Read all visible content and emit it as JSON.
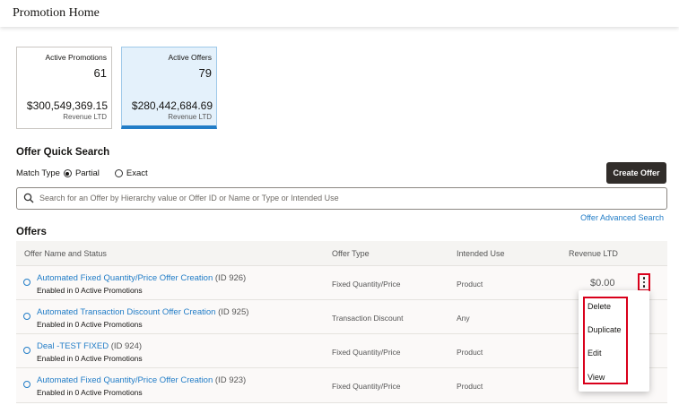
{
  "header": {
    "title": "Promotion Home"
  },
  "cards": [
    {
      "label": "Active Promotions",
      "count": "61",
      "amount": "$300,549,369.15",
      "sub": "Revenue LTD",
      "selected": false
    },
    {
      "label": "Active Offers",
      "count": "79",
      "amount": "$280,442,684.69",
      "sub": "Revenue LTD",
      "selected": true
    }
  ],
  "quick_search": {
    "title": "Offer Quick Search",
    "match_type_label": "Match Type",
    "partial_label": "Partial",
    "exact_label": "Exact",
    "selected": "Partial",
    "create_button": "Create Offer",
    "placeholder": "Search for an Offer by Hierarchy value or Offer ID or Name or Type or Intended Use",
    "advanced_link": "Offer Advanced Search"
  },
  "offers": {
    "title": "Offers",
    "columns": [
      "Offer Name and Status",
      "Offer Type",
      "Intended Use",
      "Revenue LTD"
    ],
    "rows": [
      {
        "name": "Automated Fixed Quantity/Price Offer Creation",
        "id": "(ID 926)",
        "status": "Enabled in 0 Active Promotions",
        "type": "Fixed Quantity/Price",
        "use": "Product",
        "revenue": "$0.00"
      },
      {
        "name": "Automated Transaction Discount Offer Creation",
        "id": "(ID 925)",
        "status": "Enabled in 0 Active Promotions",
        "type": "Transaction Discount",
        "use": "Any",
        "revenue": ""
      },
      {
        "name": "Deal -TEST FIXED",
        "id": "(ID 924)",
        "status": "Enabled in 0 Active Promotions",
        "type": "Fixed Quantity/Price",
        "use": "Product",
        "revenue": ""
      },
      {
        "name": "Automated Fixed Quantity/Price Offer Creation",
        "id": "(ID 923)",
        "status": "Enabled in 0 Active Promotions",
        "type": "Fixed Quantity/Price",
        "use": "Product",
        "revenue": ""
      }
    ]
  },
  "context_menu": {
    "items": [
      "Delete",
      "Duplicate",
      "Edit",
      "View"
    ]
  },
  "colors": {
    "accent": "#227dc7",
    "highlight": "#d9001b",
    "button_dark": "#312d2a"
  }
}
